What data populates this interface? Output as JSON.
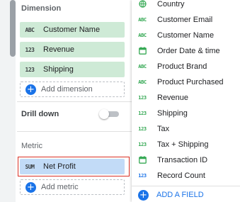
{
  "left": {
    "dimension_title": "Dimension",
    "dimensions": [
      {
        "badge": "ABC",
        "label": "Customer Name"
      },
      {
        "badge": "123",
        "label": "Revenue"
      },
      {
        "badge": "123",
        "label": "Shipping"
      }
    ],
    "add_dimension": "Add dimension",
    "drill_down": "Drill down",
    "metric_title": "Metric",
    "metric": {
      "badge": "SUM",
      "label": "Net Profit"
    },
    "add_metric": "Add metric"
  },
  "dropdown": {
    "fields": [
      {
        "type": "geo",
        "label": "Country"
      },
      {
        "type": "ABC",
        "label": "Customer Email"
      },
      {
        "type": "ABC",
        "label": "Customer Name"
      },
      {
        "type": "date",
        "label": "Order Date & time"
      },
      {
        "type": "ABC",
        "label": "Product Brand"
      },
      {
        "type": "ABC",
        "label": "Product Purchased"
      },
      {
        "type": "123",
        "label": "Revenue"
      },
      {
        "type": "123",
        "label": "Shipping"
      },
      {
        "type": "123",
        "label": "Tax"
      },
      {
        "type": "123",
        "label": "Tax + Shipping"
      },
      {
        "type": "date",
        "label": "Transaction ID"
      },
      {
        "type": "123",
        "label": "Record Count"
      }
    ],
    "add_field": "ADD A FIELD"
  },
  "colors": {
    "dimension_chip": "#ceead6",
    "metric_chip": "#c2dbf7",
    "accent": "#1a73e8",
    "field_icon": "#34a853",
    "highlight": "#d93025"
  }
}
